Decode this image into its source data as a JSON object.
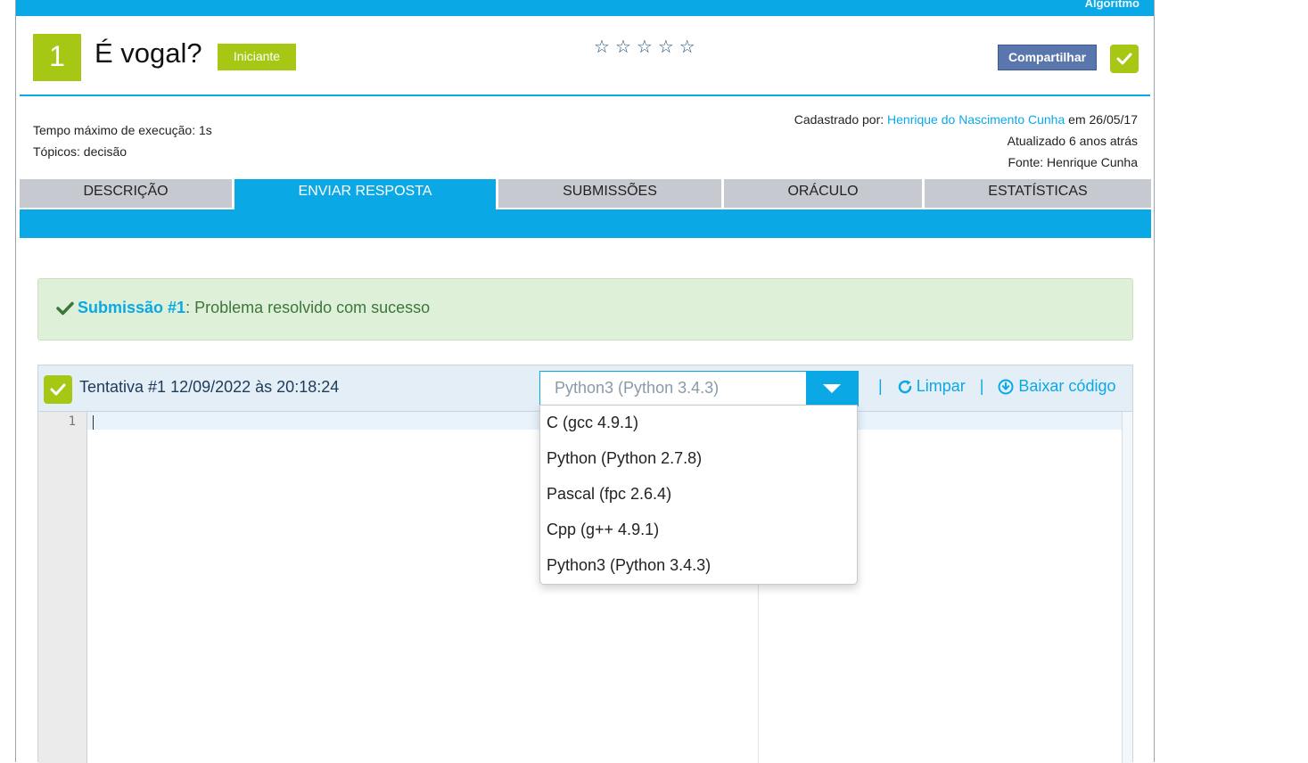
{
  "topbar": {
    "label": "Algoritmo"
  },
  "problem": {
    "number": "1",
    "title": "É vogal?",
    "level": "Iniciante",
    "stars": [
      "☆",
      "☆",
      "☆",
      "☆",
      "☆"
    ],
    "share_label": "Compartilhar"
  },
  "meta": {
    "time_limit": "Tempo máximo de execução: 1s",
    "topics": "Tópicos: decisão",
    "registered_prefix": "Cadastrado por: ",
    "registered_by": "Henrique do Nascimento Cunha",
    "registered_suffix": " em 26/05/17",
    "updated": "Atualizado 6 anos atrás",
    "source": "Fonte: Henrique Cunha"
  },
  "tabs": [
    {
      "label": "DESCRIÇÃO"
    },
    {
      "label": "ENVIAR RESPOSTA"
    },
    {
      "label": "SUBMISSÕES"
    },
    {
      "label": "ORÁCULO"
    },
    {
      "label": "ESTATÍSTICAS"
    }
  ],
  "alert": {
    "link_text": "Submissão #1",
    "message": ": Problema resolvido com sucesso"
  },
  "editor": {
    "attempt": "Tentativa #1 12/09/2022 às 20:18:24",
    "selected_language": "Python3 (Python 3.4.3)",
    "clear_label": "Limpar",
    "download_label": "Baixar código",
    "line_number": "1"
  },
  "language_options": [
    "C (gcc 4.9.1)",
    "Python (Python 2.7.8)",
    "Pascal (fpc 2.6.4)",
    "Cpp (g++ 4.9.1)",
    "Python3 (Python 3.4.3)"
  ],
  "colors": {
    "accent_blue": "#0aa9e6",
    "lime": "#a6c814",
    "facebook_blue": "#5a77ad",
    "success_bg": "#dff0d8",
    "success_text": "#3c763d"
  }
}
